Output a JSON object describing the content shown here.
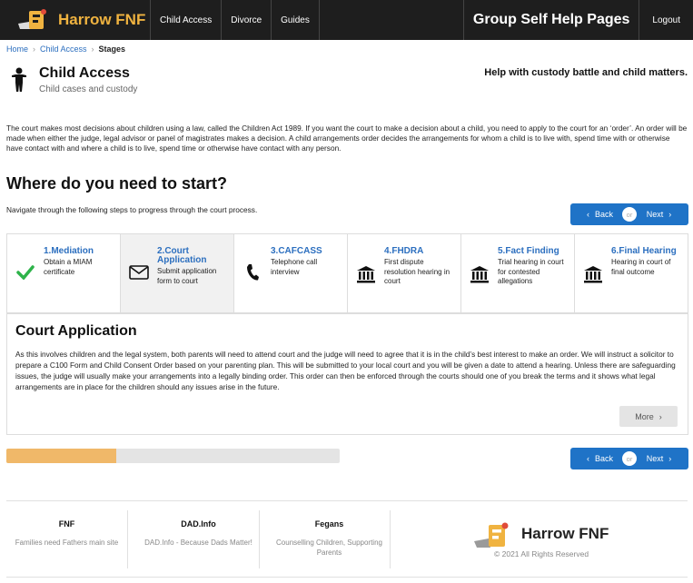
{
  "navbar": {
    "brand": "Harrow FNF",
    "links": [
      "Child Access",
      "Divorce",
      "Guides"
    ],
    "title": "Group Self Help Pages",
    "logout": "Logout"
  },
  "breadcrumb": {
    "home": "Home",
    "section": "Child Access",
    "current": "Stages"
  },
  "header": {
    "icon": "person-icon",
    "title": "Child Access",
    "subtitle": "Child cases and custody",
    "tagline": "Help with custody battle and child matters."
  },
  "intro": "The court makes most decisions about children using a law, called the Children Act 1989. If you want the court to make a decision about a child, you need to apply to the court for an ‘order’. An order will be made when either the judge, legal advisor or panel of magistrates makes a decision. A child arrangements order decides the arrangements for whom a child is to live with, spend time with or otherwise have contact with and where a child is to live, spend time or otherwise have contact with any person.",
  "section": {
    "heading": "Where do you need to start?",
    "instructions": "Navigate through the following steps to progress through the court process."
  },
  "pager": {
    "back": "Back",
    "or": "or",
    "next": "Next"
  },
  "steps": [
    {
      "title": "1.Mediation",
      "desc": "Obtain a MIAM certificate",
      "icon": "checkmark-icon",
      "active": false
    },
    {
      "title": "2.Court Application",
      "desc": "Submit application form to court",
      "icon": "envelope-icon",
      "active": true
    },
    {
      "title": "3.CAFCASS",
      "desc": "Telephone call interview",
      "icon": "phone-icon",
      "active": false
    },
    {
      "title": "4.FHDRA",
      "desc": "First dispute resolution hearing in court",
      "icon": "courthouse-icon",
      "active": false
    },
    {
      "title": "5.Fact Finding",
      "desc": "Trial hearing in court for contested allegations",
      "icon": "courthouse-icon",
      "active": false
    },
    {
      "title": "6.Final Hearing",
      "desc": "Hearing in court of final outcome",
      "icon": "courthouse-icon",
      "active": false
    }
  ],
  "panel": {
    "title": "Court Application",
    "body": "As this involves children and the legal system, both parents will need to attend court and the judge will need to agree that it is in the child’s best interest to make an order. We will instruct a solicitor to prepare a C100 Form and Child Consent Order based on your parenting plan. This will be submitted to your local court and you will be given a date to attend a hearing. Unless there are safeguarding issues, the judge will usually make your arrangements into a legally binding order. This order can then be enforced through the courts should one of you break the terms and it shows what legal arrangements are in place for the children should any issues arise in the future.",
    "more": "More"
  },
  "progress": {
    "fraction": 0.33
  },
  "footer": {
    "columns": [
      {
        "title": "FNF",
        "desc": "Families need Fathers main site"
      },
      {
        "title": "DAD.Info",
        "desc": "DAD.Info - Because Dads Matter!"
      },
      {
        "title": "Fegans",
        "desc": "Counselling Children, Supporting Parents"
      }
    ],
    "brand": "Harrow FNF",
    "copyright": "© 2021 All Rights Reserved"
  },
  "colors": {
    "accent": "#f0b340",
    "link": "#2c6fbf",
    "button": "#1f73c7",
    "progress": "#f0b869",
    "check": "#2eb34a"
  }
}
